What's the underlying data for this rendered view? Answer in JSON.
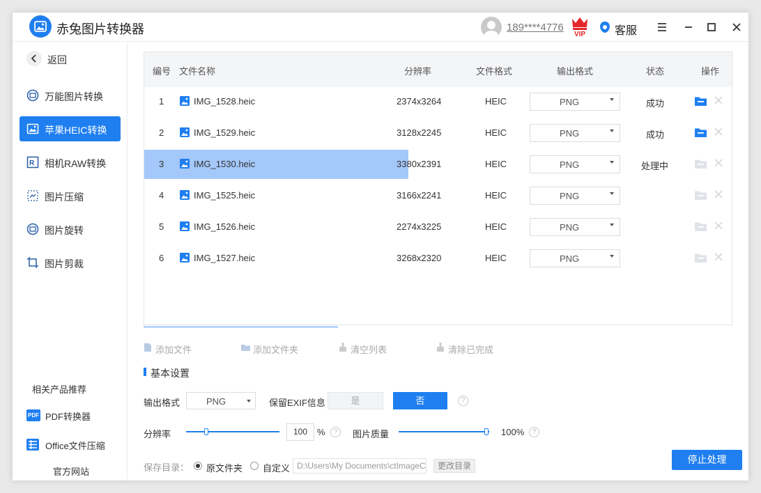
{
  "app": {
    "title": "赤兔图片转换器"
  },
  "titlebar": {
    "user_phone": "189****4776",
    "vip_text": "VIP",
    "service_label": "客服"
  },
  "sidebar": {
    "back_label": "返回",
    "items": [
      {
        "label": "万能图片转换",
        "icon": "convert-icon",
        "active": false
      },
      {
        "label": "苹果HEIC转换",
        "icon": "heic-icon",
        "active": true
      },
      {
        "label": "相机RAW转换",
        "icon": "raw-icon",
        "active": false
      },
      {
        "label": "图片压缩",
        "icon": "compress-icon",
        "active": false
      },
      {
        "label": "图片旋转",
        "icon": "rotate-icon",
        "active": false
      },
      {
        "label": "图片剪裁",
        "icon": "crop-icon",
        "active": false
      }
    ],
    "related_title": "相关产品推荐",
    "related": [
      {
        "label": "PDF转换器",
        "icon_text": "PDF"
      },
      {
        "label": "Office文件压缩"
      }
    ],
    "official_site": "官方网站"
  },
  "table": {
    "headers": [
      "编号",
      "文件名称",
      "分辨率",
      "文件格式",
      "输出格式",
      "状态",
      "操作"
    ],
    "rows": [
      {
        "no": "1",
        "name": "IMG_1528.heic",
        "resolution": "2374x3264",
        "format": "HEIC",
        "output": "PNG",
        "status": "成功",
        "progress": 0,
        "done": true
      },
      {
        "no": "2",
        "name": "IMG_1529.heic",
        "resolution": "3128x2245",
        "format": "HEIC",
        "output": "PNG",
        "status": "成功",
        "progress": 0,
        "done": true
      },
      {
        "no": "3",
        "name": "IMG_1530.heic",
        "resolution": "3380x2391",
        "format": "HEIC",
        "output": "PNG",
        "status": "处理中",
        "progress": 0.45,
        "done": false
      },
      {
        "no": "4",
        "name": "IMG_1525.heic",
        "resolution": "3166x2241",
        "format": "HEIC",
        "output": "PNG",
        "status": "",
        "progress": 0,
        "done": false
      },
      {
        "no": "5",
        "name": "IMG_1526.heic",
        "resolution": "2274x3225",
        "format": "HEIC",
        "output": "PNG",
        "status": "",
        "progress": 0,
        "done": false
      },
      {
        "no": "6",
        "name": "IMG_1527.heic",
        "resolution": "3268x2320",
        "format": "HEIC",
        "output": "PNG",
        "status": "",
        "progress": 0,
        "done": false
      }
    ]
  },
  "toolbar": {
    "add_file": "添加文件",
    "add_folder": "添加文件夹",
    "clear_list": "清空列表",
    "clear_done": "清除已完成"
  },
  "settings": {
    "section_title": "基本设置",
    "output_format_label": "输出格式",
    "output_format_value": "PNG",
    "exif_label": "保留EXIF信息",
    "exif_yes": "是",
    "exif_no": "否",
    "exif_selected": "否",
    "resolution_label": "分辨率",
    "resolution_value": "100",
    "resolution_unit": "%",
    "quality_label": "图片质量",
    "quality_value": "100%",
    "save_dir_label": "保存目录：",
    "save_option_original": "原文件夹",
    "save_option_custom": "自定义",
    "save_selected": "原文件夹",
    "save_path": "D:\\Users\\My Documents\\ctImageC",
    "change_dir": "更改目录",
    "stop_button": "停止处理",
    "help_glyph": "?"
  },
  "colors": {
    "accent": "#1f7ff0",
    "progress": "#a4c8fa"
  }
}
